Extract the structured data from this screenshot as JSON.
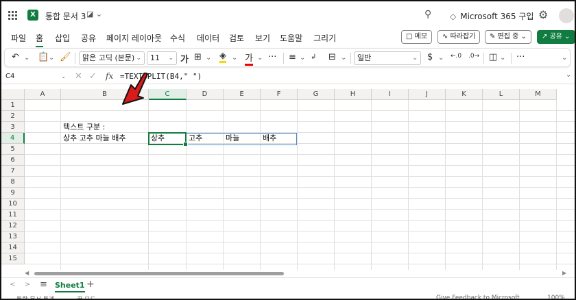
{
  "titlebar": {
    "doc_title": "통합 문서 3",
    "product": "Microsoft 365 구입"
  },
  "menu": {
    "tabs": [
      "파일",
      "홈",
      "삽입",
      "공유",
      "페이지 레이아웃",
      "수식",
      "데이터",
      "검토",
      "보기",
      "도움말",
      "그리기"
    ],
    "active_tab": "홈",
    "memo_label": "메모",
    "follow_label": "따라잡기",
    "edit_label": "편집 중",
    "share_label": "공유"
  },
  "ribbon": {
    "font_name": "맑은 고딕 (본문)",
    "font_size": "11",
    "bold_glyph": "가",
    "font_color_glyph": "가",
    "number_format": "일반",
    "currency_glyph": "$"
  },
  "formula_bar": {
    "name_box": "C4",
    "fx_label": "fx",
    "formula": "=TEXTSPLIT(B4,\" \")"
  },
  "grid": {
    "columns": [
      "A",
      "B",
      "C",
      "D",
      "E",
      "F",
      "G",
      "H",
      "I",
      "J",
      "K",
      "L",
      "M"
    ],
    "rows": [
      "1",
      "2",
      "3",
      "4",
      "5",
      "6",
      "7",
      "8",
      "9",
      "10",
      "11",
      "12",
      "13",
      "14",
      "15"
    ],
    "cells": {
      "B3": "텍스트 구분 :",
      "B4": "상추 고추 마늘 배추",
      "C4": "상추",
      "D4": "고추",
      "E4": "마늘",
      "F4": "배추"
    }
  },
  "sheets": {
    "active": "Sheet1",
    "add_glyph": "+"
  },
  "status": {
    "left": "통합 문서 통계",
    "mode": "꿈 모드",
    "feedback": "Give Feedback to Microsoft",
    "zoom": "100%"
  },
  "colors": {
    "excel_green": "#107c41",
    "spill_blue": "#4a86c8",
    "arrow_red": "#d81b1b"
  }
}
